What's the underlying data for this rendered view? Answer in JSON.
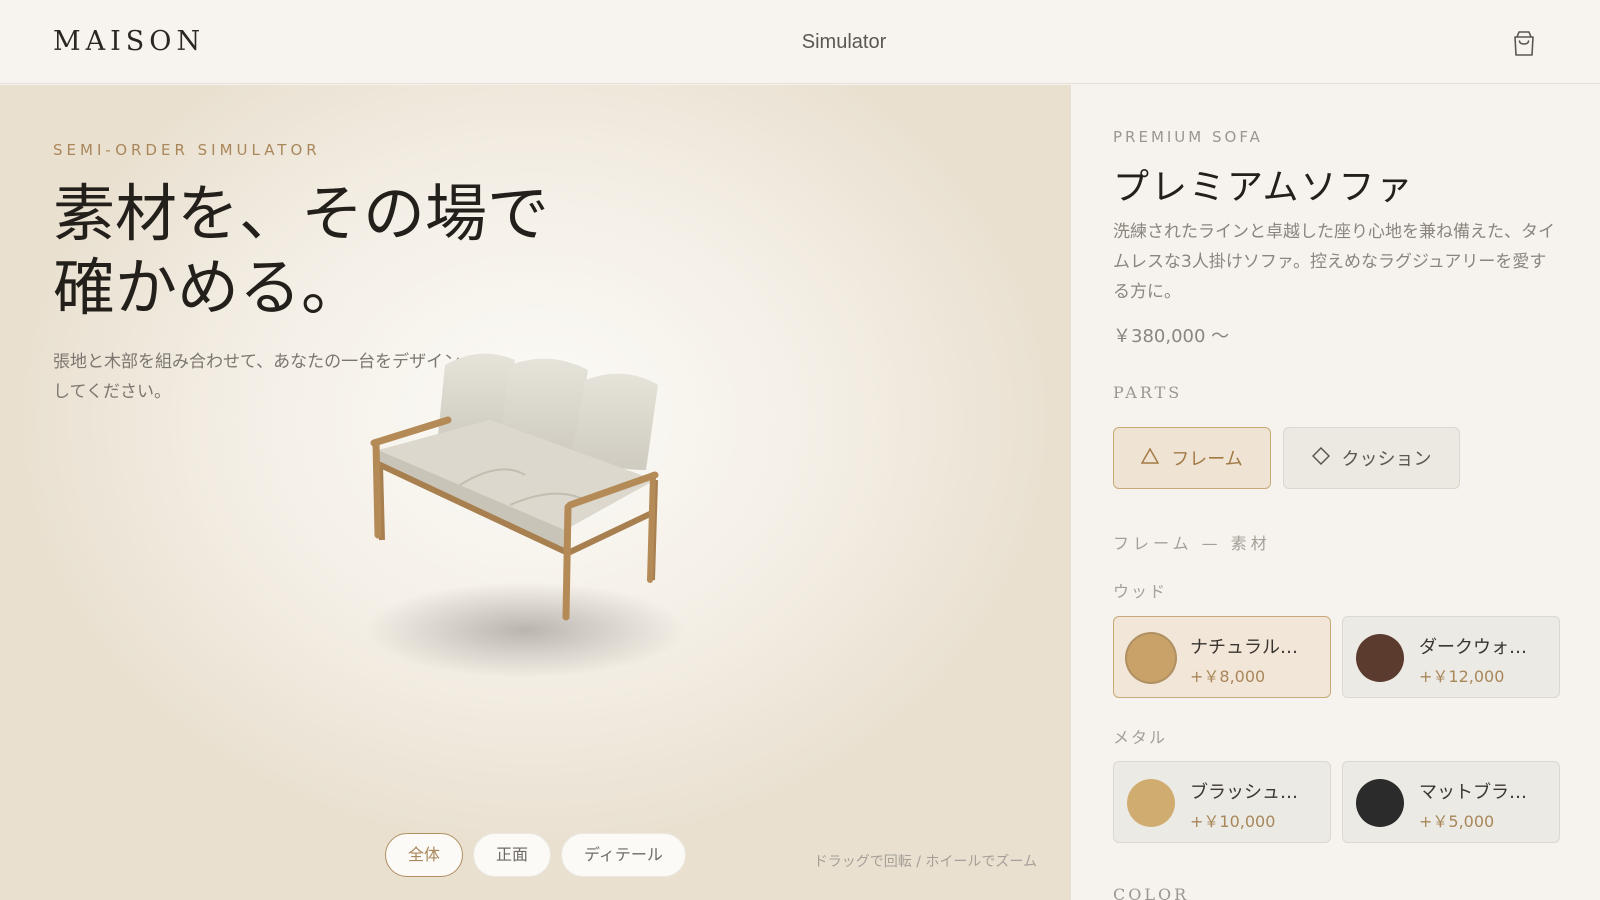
{
  "header": {
    "logo": "MAISON",
    "title": "Simulator",
    "cart_icon": "shopping-bag-icon"
  },
  "viewer": {
    "eyebrow": "SEMI-ORDER SIMULATOR",
    "headline_line1": "素材を、その場で",
    "headline_line2": "確かめる。",
    "lead": "張地と木部を組み合わせて、あなたの一台をデザインしてください。",
    "tabs": [
      {
        "label": "全体",
        "active": true
      },
      {
        "label": "正面",
        "active": false
      },
      {
        "label": "ディテール",
        "active": false
      }
    ],
    "hint": "ドラッグで回転 / ホイールでズーム"
  },
  "product": {
    "eyebrow": "PREMIUM SOFA",
    "name": "プレミアムソファ",
    "description": "洗練されたラインと卓越した座り心地を兼ね備えた、タイムレスな3人掛けソファ。控えめなラグジュアリーを愛する方に。",
    "price": "￥380,000 〜"
  },
  "parts": {
    "label": "PARTS",
    "buttons": [
      {
        "label": "フレーム",
        "icon": "triangle-icon",
        "active": true
      },
      {
        "label": "クッション",
        "icon": "diamond-icon",
        "active": false
      }
    ]
  },
  "materials": {
    "section_label": "フレーム — 素材",
    "groups": [
      {
        "label": "ウッド",
        "options": [
          {
            "name": "ナチュラル…",
            "price": "+￥8,000",
            "color": "#c9a26a",
            "active": true
          },
          {
            "name": "ダークウォ…",
            "price": "+￥12,000",
            "color": "#5a3b2e",
            "active": false
          }
        ]
      },
      {
        "label": "メタル",
        "options": [
          {
            "name": "ブラッシュ…",
            "price": "+￥10,000",
            "color": "#d0ac70",
            "active": false
          },
          {
            "name": "マットブラ…",
            "price": "+￥5,000",
            "color": "#2b2b2b",
            "active": false
          }
        ]
      }
    ]
  },
  "color_section": {
    "label": "COLOR"
  }
}
